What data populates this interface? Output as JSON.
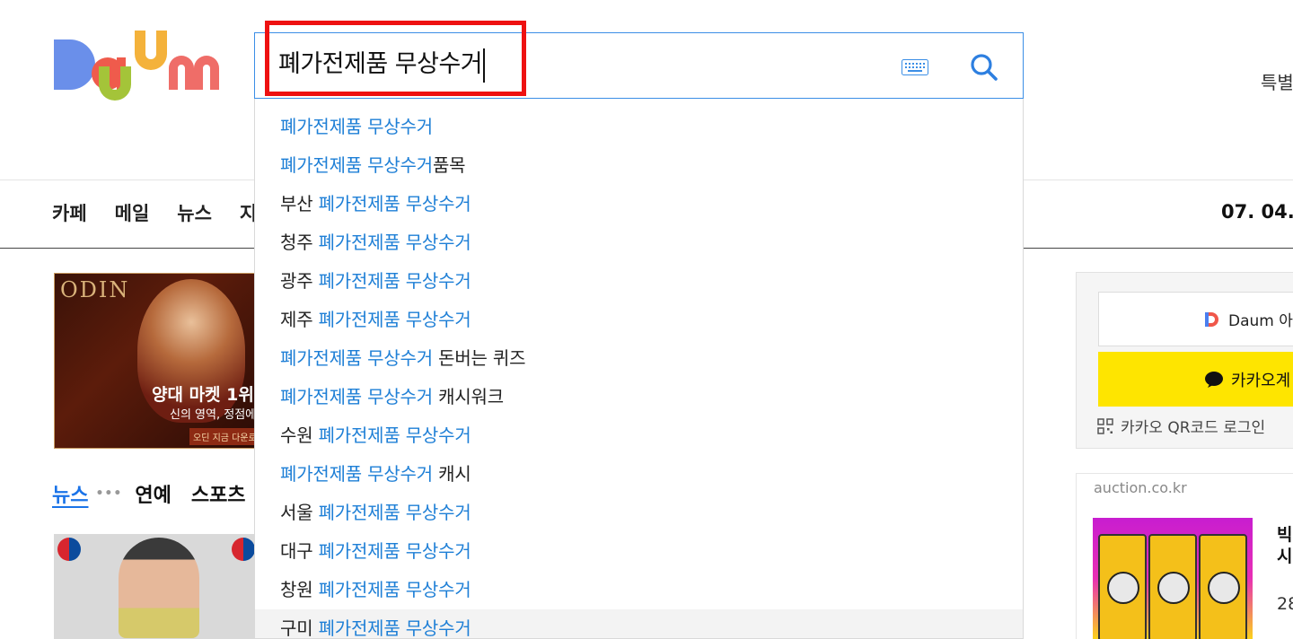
{
  "logo": {
    "text": "Daum"
  },
  "search": {
    "query": "폐가전제품 무상수거",
    "keyboard_icon": "keyboard-icon",
    "search_icon": "search-icon"
  },
  "header": {
    "top_right_text": "특별"
  },
  "nav": {
    "items": [
      "카페",
      "메일",
      "뉴스",
      "지"
    ],
    "date_text": "07. 04. ("
  },
  "suggestions": [
    {
      "prefix": "",
      "match": "폐가전제품 무상수거",
      "suffix": ""
    },
    {
      "prefix": "",
      "match": "폐가전제품 무상수거",
      "suffix": "품목"
    },
    {
      "prefix": "부산 ",
      "match": "폐가전제품 무상수거",
      "suffix": ""
    },
    {
      "prefix": "청주 ",
      "match": "폐가전제품 무상수거",
      "suffix": ""
    },
    {
      "prefix": "광주 ",
      "match": "폐가전제품 무상수거",
      "suffix": ""
    },
    {
      "prefix": "제주 ",
      "match": "폐가전제품 무상수거",
      "suffix": ""
    },
    {
      "prefix": "",
      "match": "폐가전제품 무상수거",
      "suffix": " 돈버는 퀴즈"
    },
    {
      "prefix": "",
      "match": "폐가전제품 무상수거",
      "suffix": " 캐시워크"
    },
    {
      "prefix": "수원 ",
      "match": "폐가전제품 무상수거",
      "suffix": ""
    },
    {
      "prefix": "",
      "match": "폐가전제품 무상수거",
      "suffix": " 캐시"
    },
    {
      "prefix": "서울 ",
      "match": "폐가전제품 무상수거",
      "suffix": ""
    },
    {
      "prefix": "대구 ",
      "match": "폐가전제품 무상수거",
      "suffix": ""
    },
    {
      "prefix": "창원 ",
      "match": "폐가전제품 무상수거",
      "suffix": ""
    },
    {
      "prefix": "구미 ",
      "match": "폐가전제품 무상수거",
      "suffix": ""
    }
  ],
  "banner": {
    "logo_text": "ODIN",
    "title": "양대 마켓 1위",
    "subtitle": "신의 영역, 정점에",
    "cta": "오딘 지금 다운로"
  },
  "news_tabs": {
    "active": "뉴스",
    "dots": "•••",
    "tabs": [
      "연예",
      "스포츠"
    ]
  },
  "login": {
    "daum_button": "Daum 아",
    "kakao_button": "카카오계",
    "qr_login": "카카오 QR코드 로그인"
  },
  "ad": {
    "source": "auction.co.kr",
    "title_line1": "빅",
    "title_line2": "시",
    "price": "28"
  },
  "colors": {
    "accent_blue": "#1e7fd6",
    "highlight_red": "#ee1111",
    "kakao_yellow": "#fee500"
  }
}
